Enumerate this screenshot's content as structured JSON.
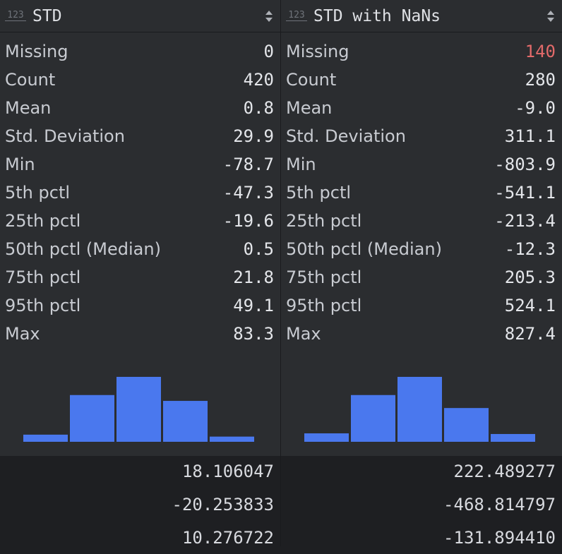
{
  "columns": [
    {
      "type_icon": "123",
      "title": "STD",
      "stats": [
        {
          "label": "Missing",
          "value": "0",
          "highlight": false
        },
        {
          "label": "Count",
          "value": "420",
          "highlight": false
        },
        {
          "label": "Mean",
          "value": "0.8",
          "highlight": false
        },
        {
          "label": "Std. Deviation",
          "value": "29.9",
          "highlight": false
        },
        {
          "label": "Min",
          "value": "-78.7",
          "highlight": false
        },
        {
          "label": "5th pctl",
          "value": "-47.3",
          "highlight": false
        },
        {
          "label": "25th pctl",
          "value": "-19.6",
          "highlight": false
        },
        {
          "label": "50th pctl (Median)",
          "value": "0.5",
          "highlight": false
        },
        {
          "label": "75th pctl",
          "value": "21.8",
          "highlight": false
        },
        {
          "label": "95th pctl",
          "value": "49.1",
          "highlight": false
        },
        {
          "label": "Max",
          "value": "83.3",
          "highlight": false
        }
      ],
      "histogram": [
        0.11,
        0.72,
        1.0,
        0.63,
        0.08
      ],
      "values": [
        "18.106047",
        "-20.253833",
        "10.276722"
      ]
    },
    {
      "type_icon": "123",
      "title": "STD with NaNs",
      "stats": [
        {
          "label": "Missing",
          "value": "140",
          "highlight": true
        },
        {
          "label": "Count",
          "value": "280",
          "highlight": false
        },
        {
          "label": "Mean",
          "value": "-9.0",
          "highlight": false
        },
        {
          "label": "Std. Deviation",
          "value": "311.1",
          "highlight": false
        },
        {
          "label": "Min",
          "value": "-803.9",
          "highlight": false
        },
        {
          "label": "5th pctl",
          "value": "-541.1",
          "highlight": false
        },
        {
          "label": "25th pctl",
          "value": "-213.4",
          "highlight": false
        },
        {
          "label": "50th pctl (Median)",
          "value": "-12.3",
          "highlight": false
        },
        {
          "label": "75th pctl",
          "value": "205.3",
          "highlight": false
        },
        {
          "label": "95th pctl",
          "value": "524.1",
          "highlight": false
        },
        {
          "label": "Max",
          "value": "827.4",
          "highlight": false
        }
      ],
      "histogram": [
        0.13,
        0.72,
        1.0,
        0.52,
        0.12
      ],
      "values": [
        "222.489277",
        "-468.814797",
        "-131.894410"
      ]
    }
  ],
  "colors": {
    "bar": "#4a78ee",
    "missing_highlight": "#e26a6a",
    "panel": "#2b2d30",
    "data_bg": "#1e1f22"
  }
}
